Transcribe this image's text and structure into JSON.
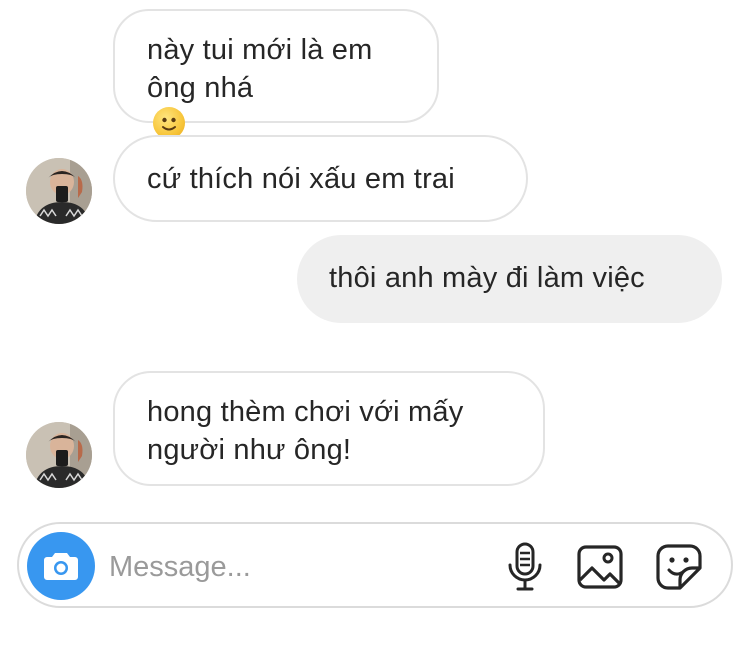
{
  "messages": [
    {
      "direction": "incoming",
      "lines": [
        "này tui mới là em",
        "ông nhá"
      ],
      "emoji": "slightly-smiling-face"
    },
    {
      "direction": "incoming",
      "lines": [
        "cứ thích nói xấu em trai"
      ],
      "avatar": true
    },
    {
      "direction": "outgoing",
      "lines": [
        "thôi anh mày đi làm việc"
      ]
    },
    {
      "direction": "incoming",
      "lines": [
        "hong thèm chơi với mấy",
        "người như ông!"
      ],
      "avatar": true
    }
  ],
  "composer": {
    "placeholder": "Message...",
    "icons": [
      "camera-icon",
      "microphone-icon",
      "gallery-icon",
      "sticker-icon"
    ]
  },
  "colors": {
    "accent": "#3897f0",
    "outgoing_bubble": "#efefef",
    "incoming_border": "#e3e3e3",
    "text": "#262626",
    "placeholder": "#9a9a9a"
  }
}
